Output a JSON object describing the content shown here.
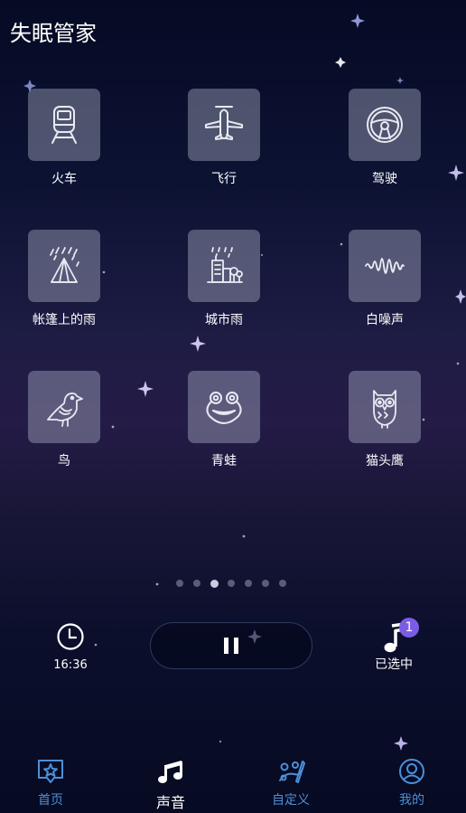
{
  "app": {
    "title": "失眠管家"
  },
  "sounds": [
    {
      "label": "火车",
      "icon": "train-icon"
    },
    {
      "label": "飞行",
      "icon": "airplane-icon"
    },
    {
      "label": "驾驶",
      "icon": "steering-wheel-icon"
    },
    {
      "label": "帐篷上的雨",
      "icon": "tent-rain-icon"
    },
    {
      "label": "城市雨",
      "icon": "city-rain-icon"
    },
    {
      "label": "白噪声",
      "icon": "waveform-icon"
    },
    {
      "label": "鸟",
      "icon": "bird-icon"
    },
    {
      "label": "青蛙",
      "icon": "frog-icon"
    },
    {
      "label": "猫头鹰",
      "icon": "owl-icon"
    }
  ],
  "pager": {
    "count": 7,
    "active_index": 2
  },
  "player": {
    "timer": {
      "icon": "clock-icon",
      "value": "16:36"
    },
    "play_state_icon": "pause-icon",
    "selected": {
      "icon": "music-note-icon",
      "count": "1",
      "label": "已选中"
    }
  },
  "tabs": [
    {
      "label": "首页",
      "icon": "home-star-icon",
      "active": false
    },
    {
      "label": "声音",
      "icon": "music-notes-icon",
      "active": true
    },
    {
      "label": "自定义",
      "icon": "custom-mix-icon",
      "active": false
    },
    {
      "label": "我的",
      "icon": "profile-icon",
      "active": false
    }
  ],
  "colors": {
    "accent_tab": "#4d8fd8",
    "badge": "#7b5ce6",
    "tile_background": "rgba(175,178,200,0.42)",
    "background_top": "#050b24",
    "background_mid": "#241b46"
  }
}
